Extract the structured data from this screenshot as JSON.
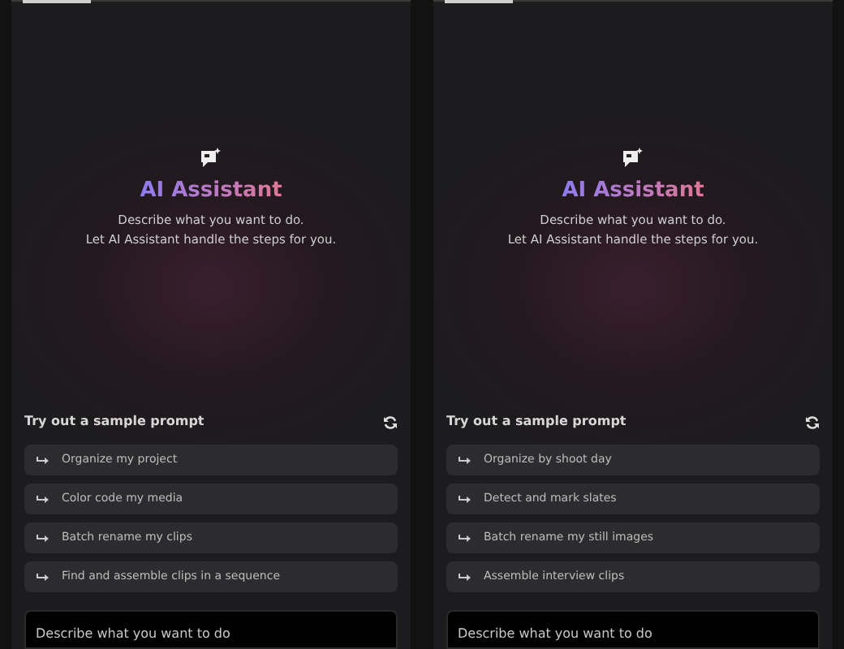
{
  "panels": [
    {
      "title": "AI Assistant",
      "description": [
        "Describe what you want to do.",
        "Let AI Assistant handle the steps for you."
      ],
      "section_title": "Try out a sample prompt",
      "prompts": [
        "Organize my project",
        "Color code my media",
        "Batch rename my clips",
        "Find and assemble clips in a sequence"
      ],
      "input": {
        "placeholder": "Describe what you want to do"
      }
    },
    {
      "title": "AI Assistant",
      "description": [
        "Describe what you want to do.",
        "Let AI Assistant handle the steps for you."
      ],
      "section_title": "Try out a sample prompt",
      "prompts": [
        "Organize by shoot day",
        "Detect and mark slates",
        "Batch rename my still images",
        "Assemble interview clips"
      ],
      "input": {
        "placeholder": "Describe what you want to do"
      }
    }
  ]
}
